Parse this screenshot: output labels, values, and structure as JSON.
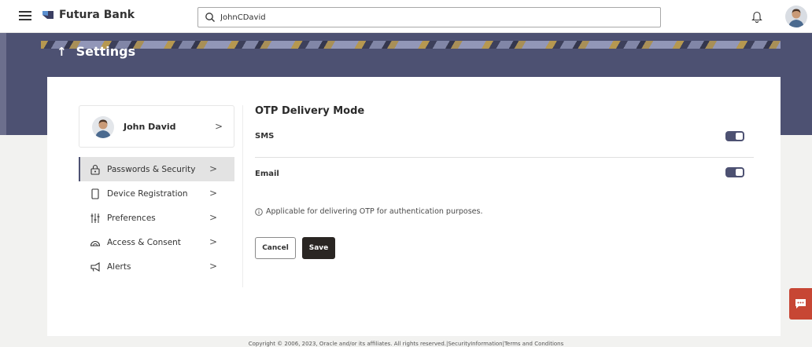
{
  "header": {
    "brand": "Futura Bank",
    "search_value": "JohnCDavid"
  },
  "banner": {
    "title": "Settings"
  },
  "profile": {
    "name": "John David"
  },
  "menu": [
    {
      "label": "Passwords & Security",
      "icon": "lock-icon",
      "active": true
    },
    {
      "label": "Device Registration",
      "icon": "device-icon",
      "active": false
    },
    {
      "label": "Preferences",
      "icon": "sliders-icon",
      "active": false
    },
    {
      "label": "Access & Consent",
      "icon": "access-icon",
      "active": false
    },
    {
      "label": "Alerts",
      "icon": "megaphone-icon",
      "active": false
    }
  ],
  "otp": {
    "title": "OTP Delivery Mode",
    "options": [
      {
        "label": "SMS",
        "enabled": true
      },
      {
        "label": "Email",
        "enabled": true
      }
    ],
    "info": "Applicable for delivering OTP for authentication purposes."
  },
  "actions": {
    "cancel": "Cancel",
    "save": "Save"
  },
  "footer": {
    "text": "Copyright © 2006, 2023, Oracle and/or its affiliates. All rights reserved.|SecurityInformation|Terms and Conditions"
  },
  "colors": {
    "brand_primary": "#4d5172",
    "save_button": "#2a2623",
    "chat_fab": "#c74634"
  }
}
